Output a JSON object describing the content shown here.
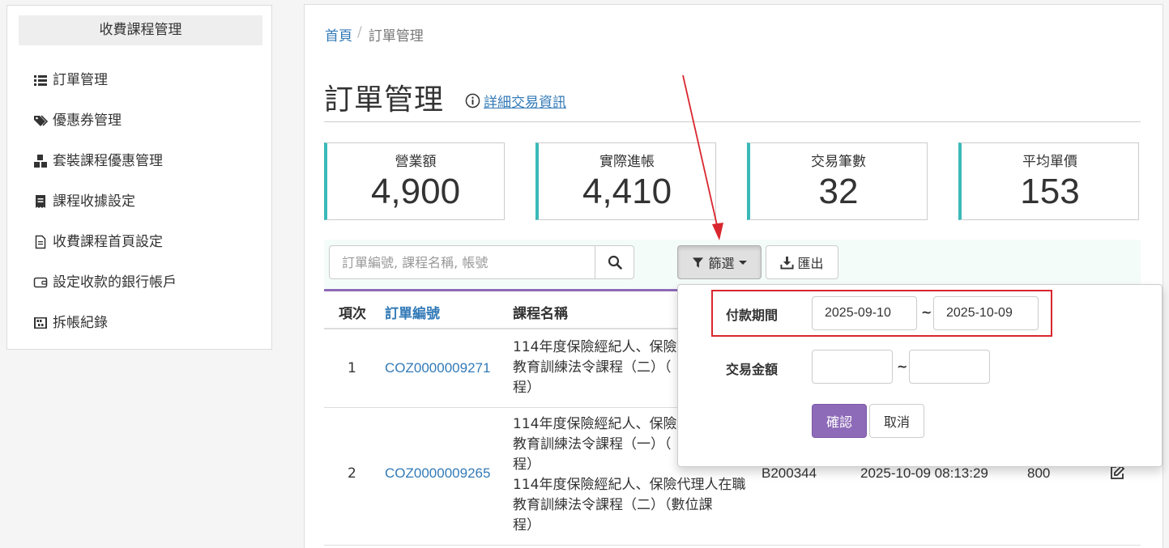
{
  "sidebar": {
    "title": "收費課程管理",
    "items": [
      {
        "label": "訂單管理",
        "icon": "list-icon"
      },
      {
        "label": "優惠券管理",
        "icon": "tags-icon"
      },
      {
        "label": "套裝課程優惠管理",
        "icon": "boxes-icon"
      },
      {
        "label": "課程收據設定",
        "icon": "receipt-icon"
      },
      {
        "label": "收費課程首頁設定",
        "icon": "file-icon"
      },
      {
        "label": "設定收款的銀行帳戶",
        "icon": "wallet-icon"
      },
      {
        "label": "拆帳紀錄",
        "icon": "abacus-icon"
      }
    ]
  },
  "breadcrumb": {
    "home": "首頁",
    "separator": "/",
    "current": "訂單管理"
  },
  "page": {
    "title": "訂單管理",
    "detail_link": "詳細交易資訊"
  },
  "stats": [
    {
      "label": "營業額",
      "value": "4,900"
    },
    {
      "label": "實際進帳",
      "value": "4,410"
    },
    {
      "label": "交易筆數",
      "value": "32"
    },
    {
      "label": "平均單價",
      "value": "153"
    }
  ],
  "toolbar": {
    "search_placeholder": "訂單編號, 課程名稱, 帳號",
    "filter_label": "篩選",
    "export_label": "匯出"
  },
  "table": {
    "headers": {
      "index": "項次",
      "order_id": "訂單編號",
      "course": "課程名稱"
    },
    "rows": [
      {
        "index": "1",
        "order_id": "COZ0000009271",
        "course_lines": [
          "114年度保險經紀人、保險",
          "教育訓練法令課程（二）（",
          "程）"
        ]
      },
      {
        "index": "2",
        "order_id": "COZ0000009265",
        "course_lines": [
          "114年度保險經紀人、保險",
          "教育訓練法令課程（一）（",
          "程）",
          "114年度保險經紀人、保險代理人在職",
          "教育訓練法令課程（二）（數位課",
          "程）"
        ],
        "account": "B200344",
        "datetime": "2025-10-09 08:13:29",
        "amount": "800"
      }
    ]
  },
  "filter_panel": {
    "period_label": "付款期間",
    "period_from": "2025-09-10",
    "period_to": "2025-10-09",
    "amount_label": "交易金額",
    "amount_from": "",
    "amount_to": "",
    "tilde": "~",
    "confirm_label": "確認",
    "cancel_label": "取消"
  },
  "colors": {
    "accent": "#8e6bb8",
    "stat_border": "#3bb9b9",
    "link": "#337ab7",
    "annotation": "#d9262e"
  }
}
